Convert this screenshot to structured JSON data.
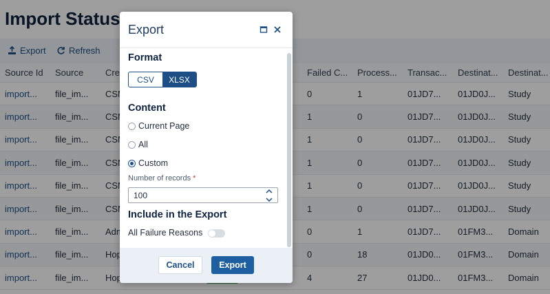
{
  "page": {
    "title": "Import Status",
    "toolbar": {
      "export_label": "Export",
      "refresh_label": "Refresh"
    }
  },
  "table": {
    "columns": [
      "Source Id",
      "Source",
      "Crea",
      "Failed C...",
      "Process...",
      "Transac...",
      "Destinat...",
      "Destinat..."
    ],
    "rows": [
      [
        "import...",
        "file_im...",
        "CSM",
        "0",
        "1",
        "01JD7...",
        "01JD0J...",
        "Study"
      ],
      [
        "import...",
        "file_im...",
        "CSM",
        "1",
        "0",
        "01JD7...",
        "01JD0J...",
        "Study"
      ],
      [
        "import...",
        "file_im...",
        "CSM",
        "1",
        "0",
        "01JD7...",
        "01JD0J...",
        "Study"
      ],
      [
        "import...",
        "file_im...",
        "CSM",
        "1",
        "0",
        "01JD7...",
        "01JD0J...",
        "Study"
      ],
      [
        "import...",
        "file_im...",
        "CSM",
        "1",
        "0",
        "01JD7...",
        "01JD0J...",
        "Study"
      ],
      [
        "import...",
        "file_im...",
        "CSM",
        "1",
        "0",
        "01JD7...",
        "01JD0J...",
        "Study"
      ],
      [
        "import...",
        "file_im...",
        "Adm",
        "0",
        "1",
        "01JD7...",
        "01FM3...",
        "Domain"
      ],
      [
        "import...",
        "file_im...",
        "Hop",
        "0",
        "18",
        "01JD0...",
        "01FM3...",
        "Domain"
      ],
      [
        "import...",
        "file_im...",
        "Hop",
        "4",
        "27",
        "01JD0...",
        "01FM3...",
        "Domain"
      ]
    ]
  },
  "modal": {
    "title": "Export",
    "format": {
      "heading": "Format",
      "options": [
        "CSV",
        "XLSX"
      ],
      "selected": "XLSX"
    },
    "content": {
      "heading": "Content",
      "options": [
        "Current Page",
        "All",
        "Custom"
      ],
      "selected": "Custom",
      "records_label": "Number of records",
      "required_mark": "*",
      "records_value": "100"
    },
    "include": {
      "heading": "Include in the Export",
      "toggle_label": "All Failure Reasons",
      "toggle_on": false
    },
    "footer": {
      "cancel_label": "Cancel",
      "export_label": "Export"
    }
  },
  "colors": {
    "accent": "#1d4f86",
    "primary_button": "#1d5fa0",
    "status_green": "#2e8b3e",
    "title": "#0d2240"
  }
}
